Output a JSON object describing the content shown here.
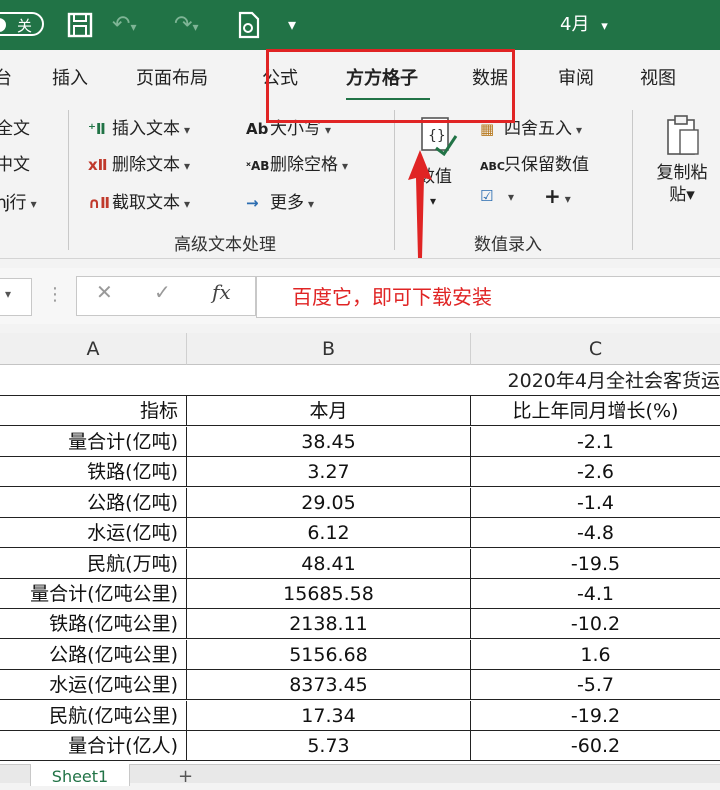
{
  "titlebar": {
    "toggle_label": "关",
    "doc_title": "4月",
    "caret": "▾",
    "save_icon": "save-icon",
    "undo_icon": "undo-icon",
    "redo_icon": "redo-icon"
  },
  "tabs": [
    {
      "label": "台"
    },
    {
      "label": "插入"
    },
    {
      "label": "页面布局"
    },
    {
      "label": "公式"
    },
    {
      "label": "方方格子"
    },
    {
      "label": "数据"
    },
    {
      "label": "审阅"
    },
    {
      "label": "视图"
    }
  ],
  "ribbon": {
    "left_items": [
      "全文",
      "中文",
      "ǌ行"
    ],
    "text_group": {
      "insert_text": "插入文本",
      "delete_text": "删除文本",
      "cut_text": "截取文本",
      "case": "大小写",
      "remove_spaces": "删除空格",
      "more": "更多",
      "label": "高级文本处理"
    },
    "number_group": {
      "value_label": "数值",
      "round": "四舍五入",
      "keep_value": "只保留数值",
      "plus": "+",
      "label": "数值录入"
    },
    "paste": {
      "line1": "复制粘",
      "line2": "贴"
    }
  },
  "formula_bar": {
    "cancel": "✕",
    "confirm": "✓",
    "fx": "fx",
    "annotation": "百度它，即可下载安装"
  },
  "columns": [
    "A",
    "B",
    "C"
  ],
  "sheet": {
    "title_cell": "2020年4月全社会客货运",
    "header": {
      "a": "指标",
      "b": "本月",
      "c": "比上年同月增长(%)"
    },
    "rows": [
      {
        "a": "量合计(亿吨)",
        "b": "38.45",
        "c": "-2.1"
      },
      {
        "a": "铁路(亿吨)",
        "b": "3.27",
        "c": "-2.6"
      },
      {
        "a": "公路(亿吨)",
        "b": "29.05",
        "c": "-1.4"
      },
      {
        "a": "水运(亿吨)",
        "b": "6.12",
        "c": "-4.8"
      },
      {
        "a": "民航(万吨)",
        "b": "48.41",
        "c": "-19.5"
      },
      {
        "a": "量合计(亿吨公里)",
        "b": "15685.58",
        "c": "-4.1"
      },
      {
        "a": "铁路(亿吨公里)",
        "b": "2138.11",
        "c": "-10.2"
      },
      {
        "a": "公路(亿吨公里)",
        "b": "5156.68",
        "c": "1.6"
      },
      {
        "a": "水运(亿吨公里)",
        "b": "8373.45",
        "c": "-5.7"
      },
      {
        "a": "民航(亿吨公里)",
        "b": "17.34",
        "c": "-19.2"
      },
      {
        "a": "量合计(亿人)",
        "b": "5.73",
        "c": "-60.2"
      }
    ]
  },
  "sheet_tabs": {
    "active": "Sheet1",
    "add": "+"
  }
}
